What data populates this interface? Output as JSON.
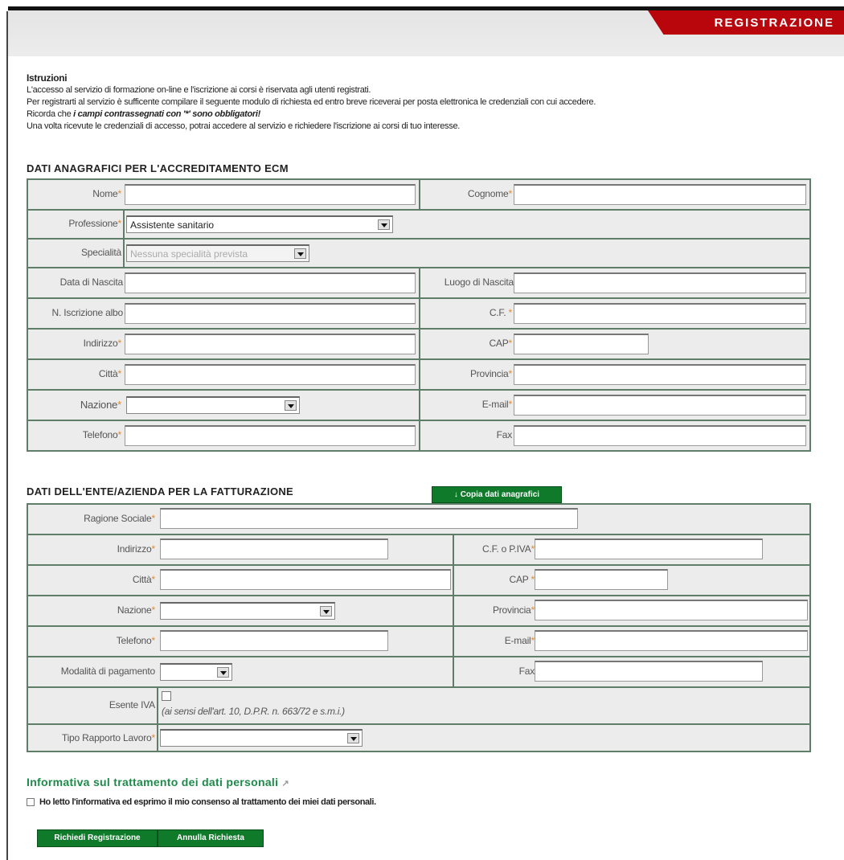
{
  "header": {
    "tab_label": "REGISTRAZIONE"
  },
  "instructions": {
    "title": "Istruzioni",
    "line1": "L'accesso al servizio di formazione on-line e l'iscrizione ai corsi è riservata agli utenti registrati.",
    "line2": "Per registrarti al servizio è sufficente compilare il seguente modulo di richiesta ed entro breve riceverai per posta elettronica le credenziali con cui accedere.",
    "line3_pre": "Ricorda che ",
    "line3_em": "i campi contrassegnati con '*' sono obbligatori!",
    "line4": "Una volta ricevute le credenziali di accesso, potrai accedere al servizio e richiedere l'iscrizione ai corsi di tuo interesse."
  },
  "section1": {
    "title": "DATI ANAGRAFICI PER L'ACCREDITAMENTO ECM",
    "nome": "Nome",
    "cognome": "Cognome",
    "professione": "Professione",
    "professione_value": "Assistente sanitario",
    "specialita": "Specialità",
    "specialita_value": "Nessuna specialità prevista",
    "data_nascita": "Data di Nascita",
    "luogo_nascita": "Luogo di Nascita",
    "iscrizione_albo": "N. Iscrizione albo",
    "cf": "C.F.",
    "indirizzo": "Indirizzo",
    "cap": "CAP",
    "citta": "Città",
    "provincia": "Provincia",
    "nazione": "Nazione",
    "email": "E-mail",
    "telefono": "Telefono",
    "fax": "Fax"
  },
  "section2": {
    "title": "DATI DELL'ENTE/AZIENDA PER LA FATTURAZIONE",
    "copy_button": "Copia dati anagrafici",
    "ragione_sociale": "Ragione Sociale",
    "indirizzo": "Indirizzo",
    "cf_piva": "C.F. o P.IVA",
    "citta": "Città",
    "cap": "CAP",
    "nazione": "Nazione",
    "provincia": "Provincia",
    "telefono": "Telefono",
    "email": "E-mail",
    "pagamento": "Modalità di pagamento",
    "fax": "Fax",
    "esente_iva": "Esente IVA",
    "esente_note": "(ai sensi dell'art. 10, D.P.R. n. 663/72 e s.m.i.)",
    "tipo_rapporto": "Tipo Rapporto Lavoro"
  },
  "privacy": {
    "title": "Informativa sul trattamento dei dati personali",
    "consent": "Ho letto l'informativa ed esprimo il mio consenso al trattamento dei miei dati personali."
  },
  "buttons": {
    "submit": "Richiedi Registrazione",
    "cancel": "Annulla Richiesta"
  },
  "required_mark": "*",
  "colors": {
    "brand_red": "#b8060c",
    "green": "#0f7a2a",
    "border": "#5e7e6a",
    "required": "#e08a2a"
  }
}
